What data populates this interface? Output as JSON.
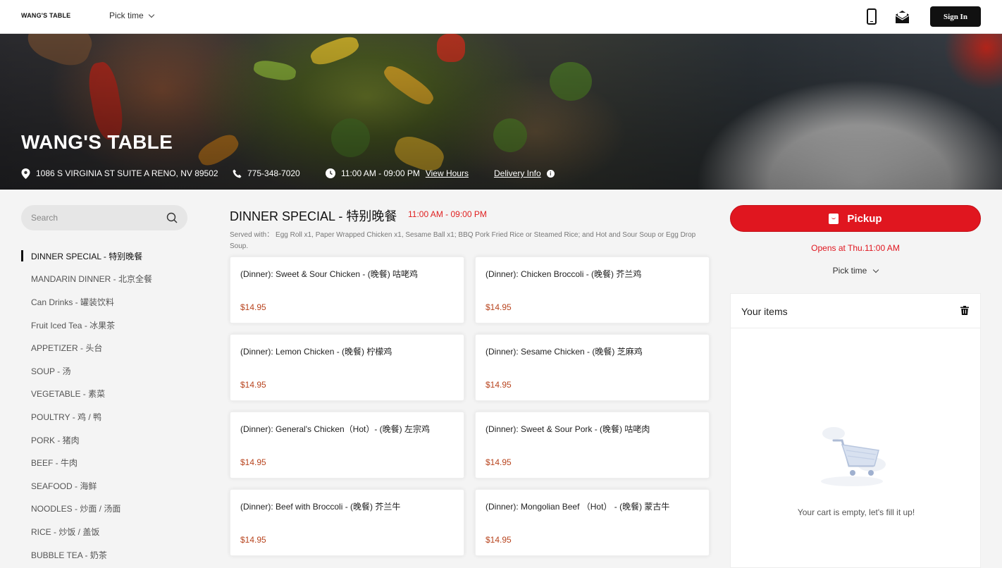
{
  "header": {
    "logo": "WANG'S TABLE",
    "pick_time": "Pick time",
    "sign_in": "Sign In"
  },
  "hero": {
    "title": "WANG'S TABLE",
    "address": "1086 S VIRGINIA ST SUITE A RENO, NV 89502",
    "phone": "775-348-7020",
    "hours": "11:00 AM - 09:00 PM",
    "view_hours": "View Hours",
    "delivery_info": "Delivery Info"
  },
  "sidebar": {
    "search_placeholder": "Search",
    "categories": [
      "DINNER SPECIAL - 特别晚餐",
      "MANDARIN DINNER - 北京全餐",
      "Can Drinks - 罐装饮料",
      "Fruit Iced Tea - 冰果茶",
      "APPETIZER - 头台",
      "SOUP - 汤",
      "VEGETABLE - 素菜",
      "POULTRY - 鸡 / 鸭",
      "PORK - 猪肉",
      "BEEF - 牛肉",
      "SEAFOOD - 海鲜",
      "NOODLES - 炒面 / 汤面",
      "RICE - 炒饭 / 盖饭",
      "BUBBLE TEA - 奶茶"
    ]
  },
  "main": {
    "section_title": "DINNER SPECIAL - 特别晚餐",
    "section_hours": "11:00 AM - 09:00 PM",
    "section_desc": "Served with： Egg Roll x1, Paper Wrapped Chicken x1, Sesame Ball x1; BBQ Pork Fried Rice or Steamed Rice; and Hot and Sour Soup or Egg Drop Soup.",
    "items": [
      {
        "name": "(Dinner): Sweet & Sour Chicken - (晚餐) 咕咾鸡",
        "price": "$14.95"
      },
      {
        "name": "(Dinner): Chicken Broccoli - (晚餐) 芥兰鸡",
        "price": "$14.95"
      },
      {
        "name": "(Dinner): Lemon Chicken - (晚餐) 柠檬鸡",
        "price": "$14.95"
      },
      {
        "name": "(Dinner): Sesame Chicken - (晚餐) 芝麻鸡",
        "price": "$14.95"
      },
      {
        "name": "(Dinner): General's Chicken（Hot）- (晚餐) 左宗鸡",
        "price": "$14.95"
      },
      {
        "name": "(Dinner): Sweet & Sour Pork - (晚餐) 咕咾肉",
        "price": "$14.95"
      },
      {
        "name": "(Dinner): Beef with Broccoli - (晚餐) 芥兰牛",
        "price": "$14.95"
      },
      {
        "name": "(Dinner): Mongolian Beef （Hot） - (晚餐) 蒙古牛",
        "price": "$14.95"
      }
    ]
  },
  "cart": {
    "pickup": "Pickup",
    "opens": "Opens at Thu.11:00 AM",
    "pick_time": "Pick time",
    "title": "Your items",
    "empty": "Your cart is empty, let's fill it up!"
  },
  "colors": {
    "accent": "#e0161f",
    "price": "#b8441e",
    "dark": "#111111"
  }
}
